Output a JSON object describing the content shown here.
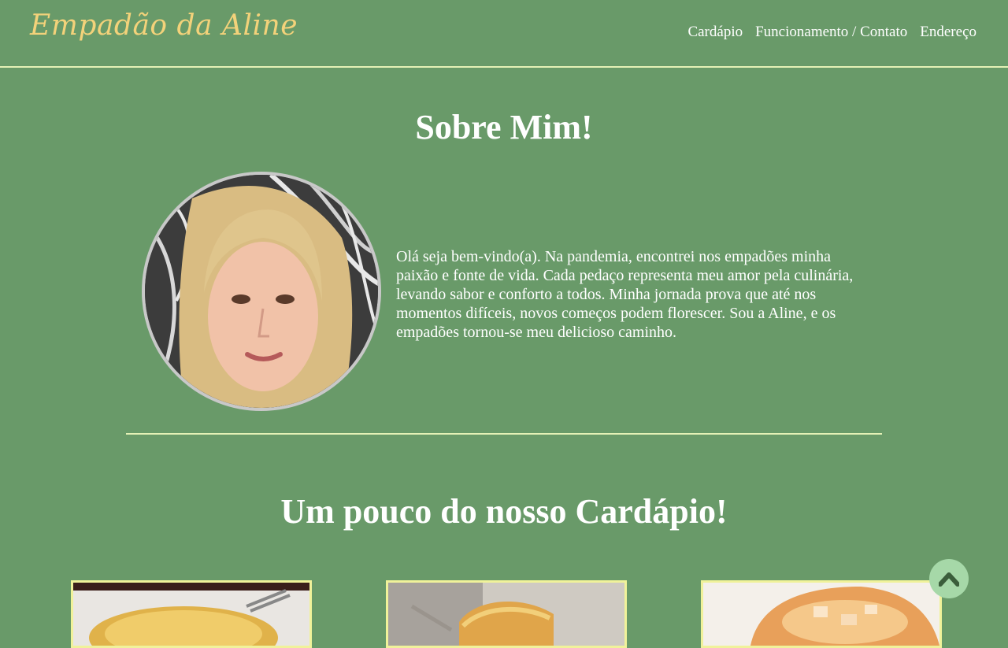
{
  "header": {
    "logo": "Empadão da Aline",
    "nav": [
      {
        "label": "Cardápio"
      },
      {
        "label": "Funcionamento / Contato"
      },
      {
        "label": "Endereço"
      }
    ]
  },
  "about": {
    "title": "Sobre Mim!",
    "text": "Olá seja bem-vindo(a). Na pandemia, encontrei nos empadões minha paixão e fonte de vida. Cada pedaço representa meu amor pela culinária, levando sabor e conforto a todos. Minha jornada prova que até nos momentos difíceis, novos começos podem florescer. Sou a Aline, e os empadões tornou-se meu delicioso caminho."
  },
  "menu": {
    "title": "Um pouco do nosso Cardápio!",
    "items": [
      {
        "icon": "pie-photo"
      },
      {
        "icon": "pie-photo"
      },
      {
        "icon": "pie-photo"
      }
    ]
  },
  "scroll_top": {
    "icon": "chevron-up-icon"
  },
  "colors": {
    "background": "#699a69",
    "accent_line": "#e4f1b6",
    "logo": "#f3d27a",
    "card_border": "#f0f29a",
    "scroll_button": "#a6d8a8"
  }
}
